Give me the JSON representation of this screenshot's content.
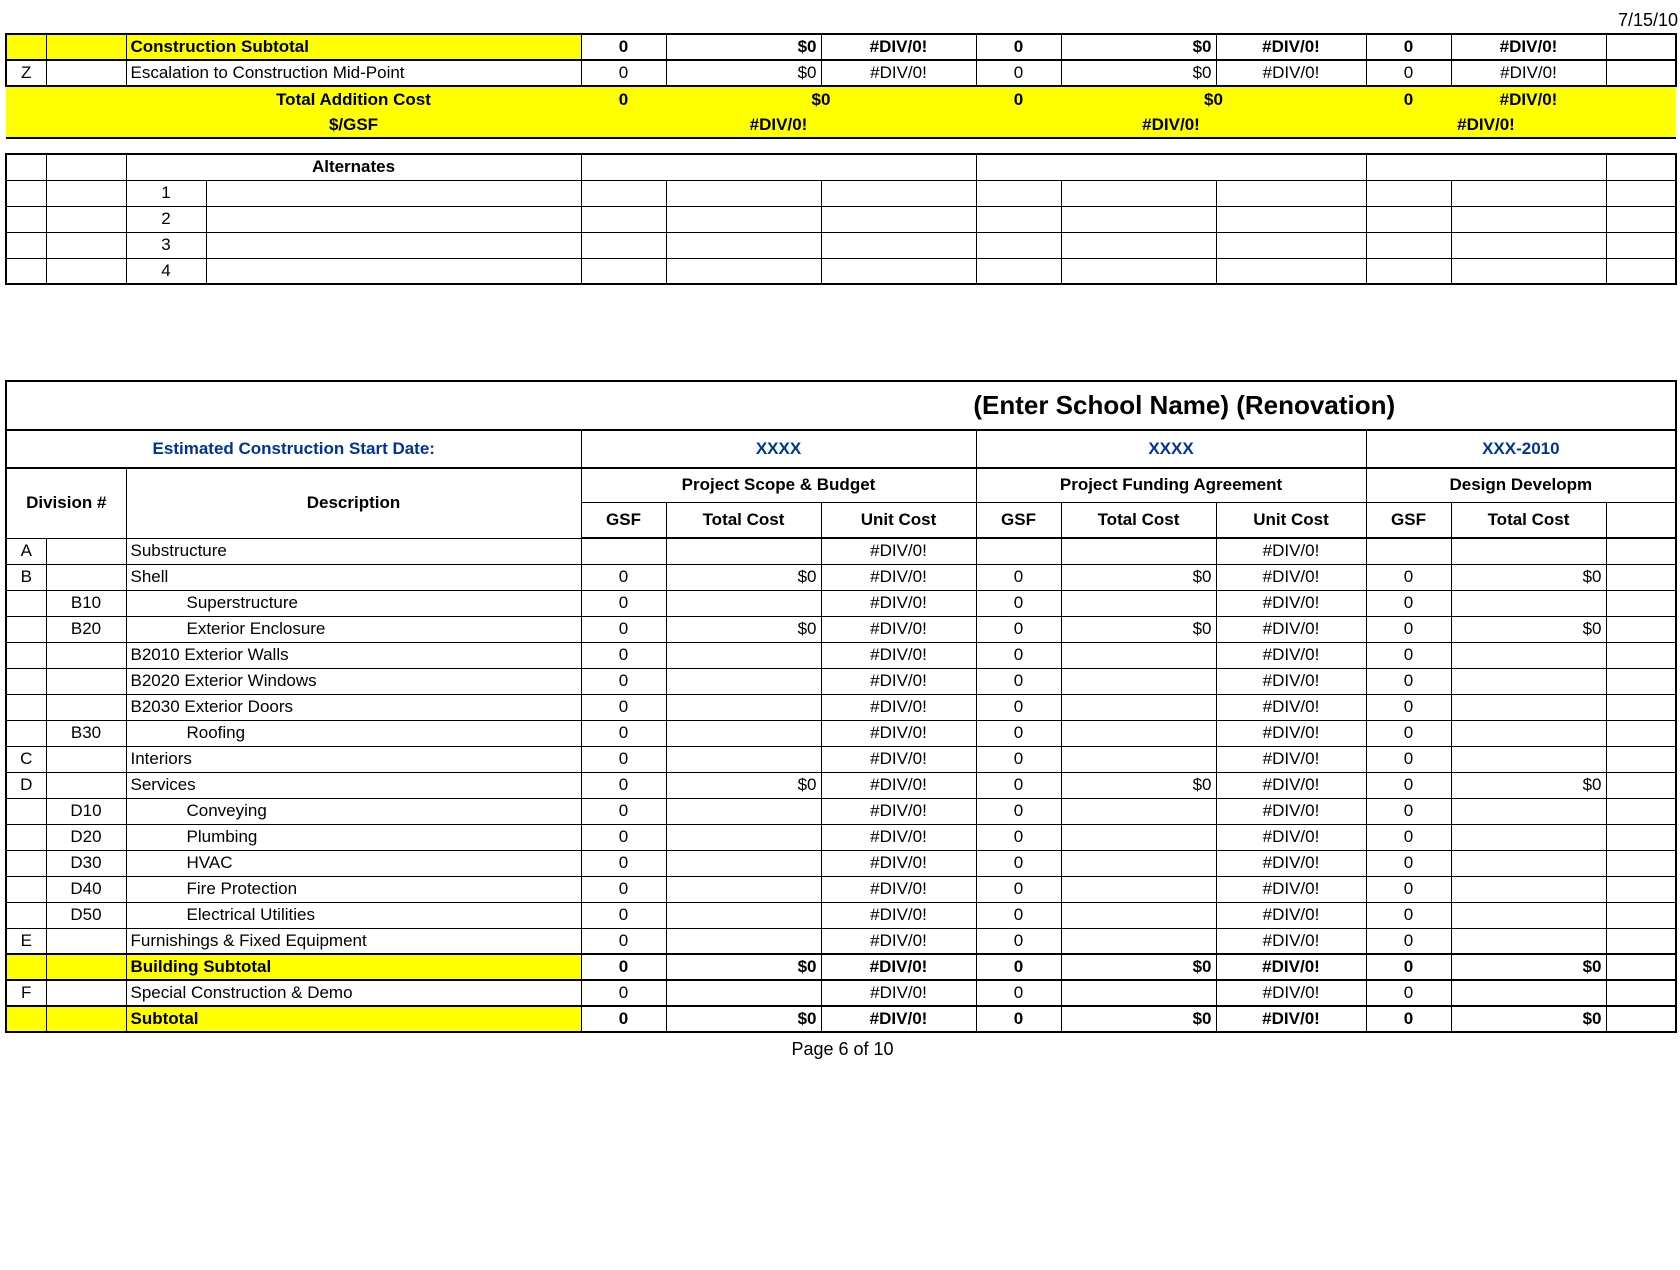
{
  "top_date": "7/15/10",
  "section1": {
    "construction_subtotal": {
      "label": "Construction Subtotal",
      "c1_gsf": "0",
      "c1_tc": "$0",
      "c1_uc": "#DIV/0!",
      "c2_gsf": "0",
      "c2_tc": "$0",
      "c2_uc": "#DIV/0!",
      "c3_gsf": "0",
      "c3_tc": "#DIV/0!"
    },
    "escalation": {
      "code": "Z",
      "label": "Escalation to Construction Mid-Point",
      "c1_gsf": "0",
      "c1_tc": "$0",
      "c1_uc": "#DIV/0!",
      "c2_gsf": "0",
      "c2_tc": "$0",
      "c2_uc": "#DIV/0!",
      "c3_gsf": "0",
      "c3_tc": "#DIV/0!"
    },
    "total_addition": {
      "label": "Total Addition Cost",
      "c1_gsf": "0",
      "c1_tc": "$0",
      "c2_gsf": "0",
      "c2_tc": "$0",
      "c3_gsf": "0",
      "c3_tc": "#DIV/0!"
    },
    "per_gsf": {
      "label": "$/GSF",
      "c1": "#DIV/0!",
      "c2": "#DIV/0!",
      "c3": "#DIV/0!"
    }
  },
  "alternates": {
    "header": "Alternates",
    "rows": [
      "1",
      "2",
      "3",
      "4"
    ]
  },
  "section2": {
    "title": "(Enter School Name) (Renovation)",
    "start_label": "Estimated Construction Start Date:",
    "phase1": "XXXX",
    "phase2": "XXXX",
    "phase3": "XXX-2010",
    "group1": "Project Scope & Budget",
    "group2": "Project Funding Agreement",
    "group3": "Design Developm",
    "col_div": "Division #",
    "col_desc": "Description",
    "col_gsf": "GSF",
    "col_tc": "Total Cost",
    "col_uc": "Unit Cost"
  },
  "rows": [
    {
      "a": "A",
      "b": "",
      "desc": "Substructure",
      "c1g": "",
      "c1t": "",
      "c1u": "#DIV/0!",
      "c2g": "",
      "c2t": "",
      "c2u": "#DIV/0!",
      "c3g": "",
      "c3t": ""
    },
    {
      "a": "B",
      "b": "",
      "desc": "Shell",
      "c1g": "0",
      "c1t": "$0",
      "c1u": "#DIV/0!",
      "c2g": "0",
      "c2t": "$0",
      "c2u": "#DIV/0!",
      "c3g": "0",
      "c3t": "$0"
    },
    {
      "a": "",
      "b": "B10",
      "desc": "Superstructure",
      "indent": 1,
      "c1g": "0",
      "c1t": "",
      "c1u": "#DIV/0!",
      "c2g": "0",
      "c2t": "",
      "c2u": "#DIV/0!",
      "c3g": "0",
      "c3t": ""
    },
    {
      "a": "",
      "b": "B20",
      "desc": "Exterior Enclosure",
      "indent": 1,
      "c1g": "0",
      "c1t": "$0",
      "c1u": "#DIV/0!",
      "c2g": "0",
      "c2t": "$0",
      "c2u": "#DIV/0!",
      "c3g": "0",
      "c3t": "$0"
    },
    {
      "a": "",
      "b": "",
      "desc": "B2010    Exterior Walls",
      "c1g": "0",
      "c1t": "",
      "c1u": "#DIV/0!",
      "c2g": "0",
      "c2t": "",
      "c2u": "#DIV/0!",
      "c3g": "0",
      "c3t": ""
    },
    {
      "a": "",
      "b": "",
      "desc": "B2020    Exterior Windows",
      "c1g": "0",
      "c1t": "",
      "c1u": "#DIV/0!",
      "c2g": "0",
      "c2t": "",
      "c2u": "#DIV/0!",
      "c3g": "0",
      "c3t": ""
    },
    {
      "a": "",
      "b": "",
      "desc": "B2030    Exterior Doors",
      "c1g": "0",
      "c1t": "",
      "c1u": "#DIV/0!",
      "c2g": "0",
      "c2t": "",
      "c2u": "#DIV/0!",
      "c3g": "0",
      "c3t": ""
    },
    {
      "a": "",
      "b": "B30",
      "desc": "Roofing",
      "indent": 1,
      "c1g": "0",
      "c1t": "",
      "c1u": "#DIV/0!",
      "c2g": "0",
      "c2t": "",
      "c2u": "#DIV/0!",
      "c3g": "0",
      "c3t": ""
    },
    {
      "a": "C",
      "b": "",
      "desc": "Interiors",
      "c1g": "0",
      "c1t": "",
      "c1u": "#DIV/0!",
      "c2g": "0",
      "c2t": "",
      "c2u": "#DIV/0!",
      "c3g": "0",
      "c3t": ""
    },
    {
      "a": "D",
      "b": "",
      "desc": "Services",
      "c1g": "0",
      "c1t": "$0",
      "c1u": "#DIV/0!",
      "c2g": "0",
      "c2t": "$0",
      "c2u": "#DIV/0!",
      "c3g": "0",
      "c3t": "$0"
    },
    {
      "a": "",
      "b": "D10",
      "desc": "Conveying",
      "indent": 1,
      "c1g": "0",
      "c1t": "",
      "c1u": "#DIV/0!",
      "c2g": "0",
      "c2t": "",
      "c2u": "#DIV/0!",
      "c3g": "0",
      "c3t": ""
    },
    {
      "a": "",
      "b": "D20",
      "desc": "Plumbing",
      "indent": 1,
      "c1g": "0",
      "c1t": "",
      "c1u": "#DIV/0!",
      "c2g": "0",
      "c2t": "",
      "c2u": "#DIV/0!",
      "c3g": "0",
      "c3t": ""
    },
    {
      "a": "",
      "b": "D30",
      "desc": "HVAC",
      "indent": 1,
      "c1g": "0",
      "c1t": "",
      "c1u": "#DIV/0!",
      "c2g": "0",
      "c2t": "",
      "c2u": "#DIV/0!",
      "c3g": "0",
      "c3t": ""
    },
    {
      "a": "",
      "b": "D40",
      "desc": "Fire Protection",
      "indent": 1,
      "c1g": "0",
      "c1t": "",
      "c1u": "#DIV/0!",
      "c2g": "0",
      "c2t": "",
      "c2u": "#DIV/0!",
      "c3g": "0",
      "c3t": ""
    },
    {
      "a": "",
      "b": "D50",
      "desc": "Electrical Utilities",
      "indent": 1,
      "c1g": "0",
      "c1t": "",
      "c1u": "#DIV/0!",
      "c2g": "0",
      "c2t": "",
      "c2u": "#DIV/0!",
      "c3g": "0",
      "c3t": ""
    },
    {
      "a": "E",
      "b": "",
      "desc": "Furnishings & Fixed Equipment",
      "c1g": "0",
      "c1t": "",
      "c1u": "#DIV/0!",
      "c2g": "0",
      "c2t": "",
      "c2u": "#DIV/0!",
      "c3g": "0",
      "c3t": ""
    }
  ],
  "building_subtotal": {
    "label": "Building Subtotal",
    "c1g": "0",
    "c1t": "$0",
    "c1u": "#DIV/0!",
    "c2g": "0",
    "c2t": "$0",
    "c2u": "#DIV/0!",
    "c3g": "0",
    "c3t": "$0"
  },
  "special": {
    "a": "F",
    "label": "Special Construction & Demo",
    "c1g": "0",
    "c1t": "",
    "c1u": "#DIV/0!",
    "c2g": "0",
    "c2t": "",
    "c2u": "#DIV/0!",
    "c3g": "0",
    "c3t": ""
  },
  "subtotal": {
    "label": "Subtotal",
    "c1g": "0",
    "c1t": "$0",
    "c1u": "#DIV/0!",
    "c2g": "0",
    "c2t": "$0",
    "c2u": "#DIV/0!",
    "c3g": "0",
    "c3t": "$0"
  },
  "footer": "Page 6 of 10"
}
